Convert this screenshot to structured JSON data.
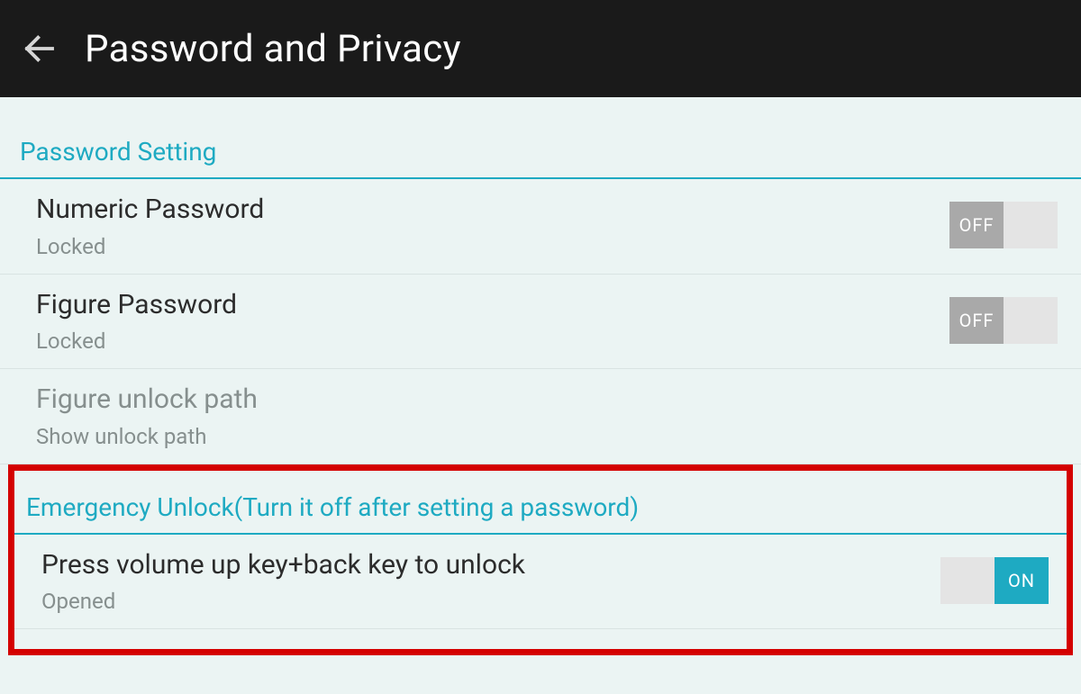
{
  "header": {
    "title": "Password and Privacy"
  },
  "sections": {
    "password_setting": {
      "header": "Password Setting",
      "items": [
        {
          "title": "Numeric Password",
          "sub": "Locked",
          "toggle": {
            "state": "off",
            "label": "OFF"
          }
        },
        {
          "title": "Figure Password",
          "sub": "Locked",
          "toggle": {
            "state": "off",
            "label": "OFF"
          }
        },
        {
          "title": "Figure unlock path",
          "sub": "Show unlock path"
        }
      ]
    },
    "emergency_unlock": {
      "header": "Emergency Unlock(Turn it off after setting a password)",
      "items": [
        {
          "title": "Press volume up key+back key to unlock",
          "sub": "Opened",
          "toggle": {
            "state": "on",
            "label": "ON"
          }
        }
      ]
    }
  }
}
